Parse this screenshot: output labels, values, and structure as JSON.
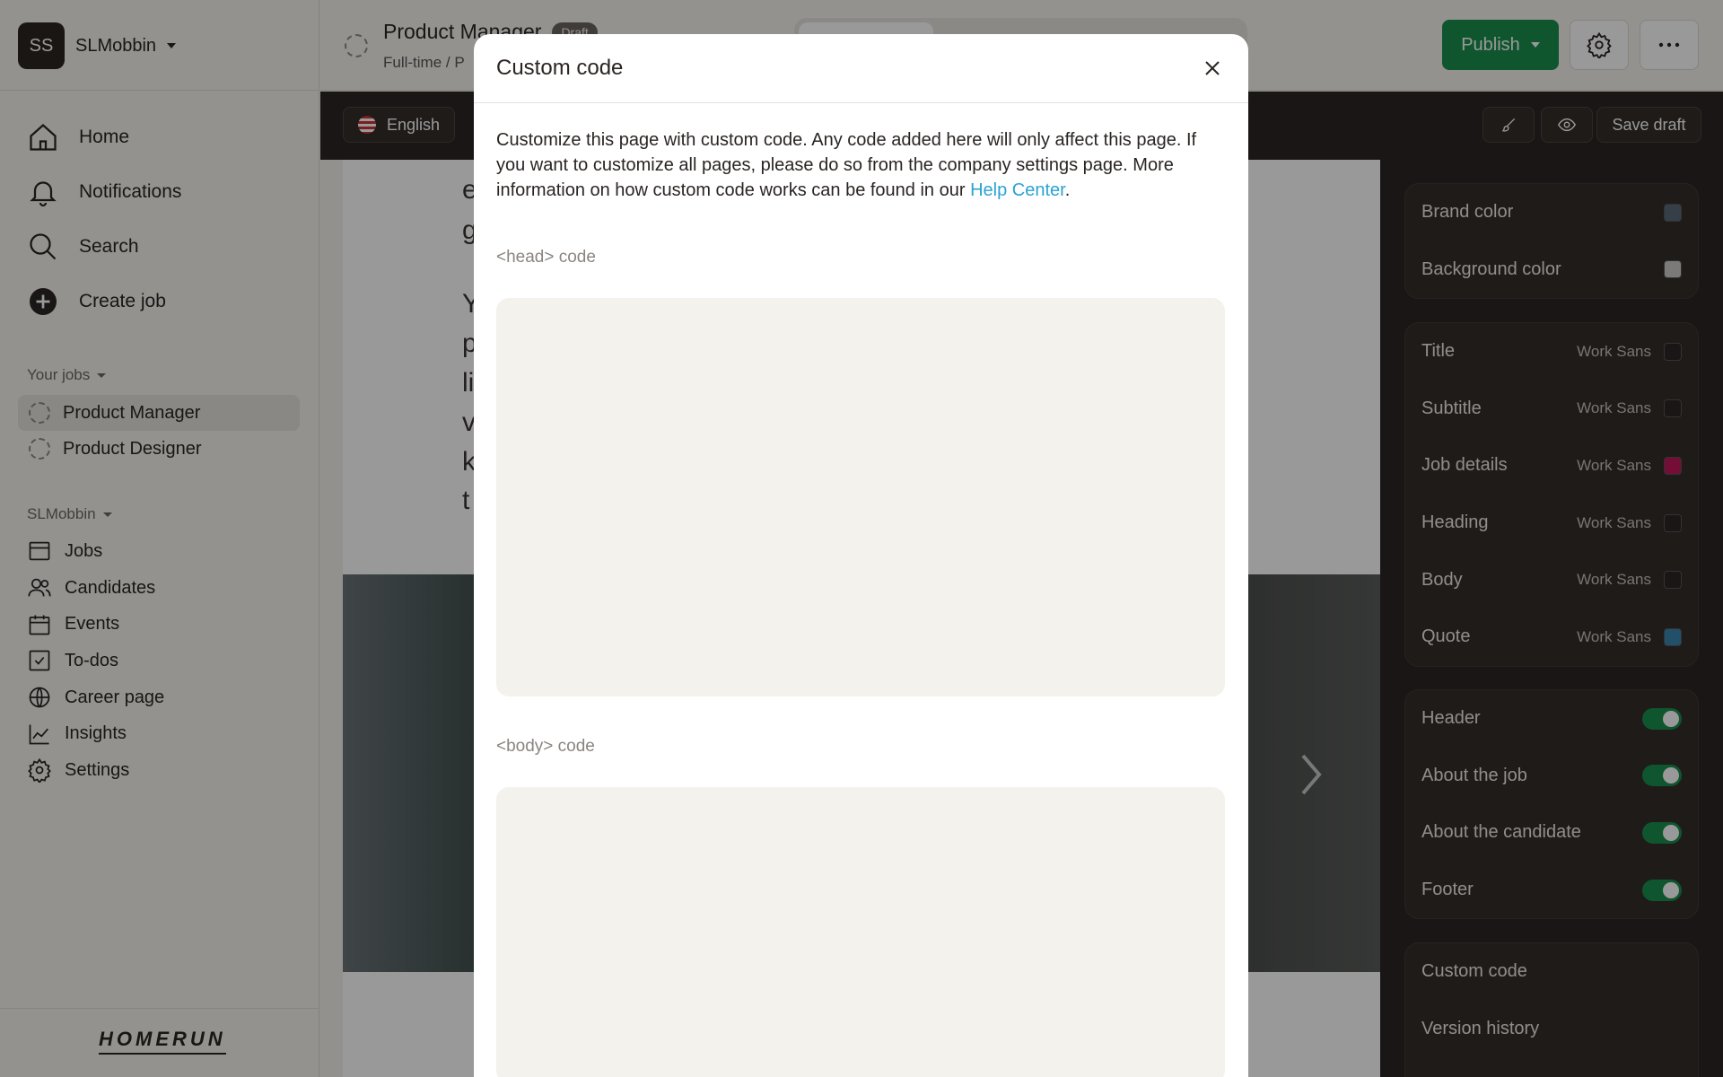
{
  "sidebar": {
    "avatar_initials": "SS",
    "workspace_name": "SLMobbin",
    "nav": [
      {
        "label": "Home",
        "icon": "home-icon"
      },
      {
        "label": "Notifications",
        "icon": "bell-icon"
      },
      {
        "label": "Search",
        "icon": "search-icon"
      },
      {
        "label": "Create job",
        "icon": "plus-circle-icon"
      }
    ],
    "your_jobs_label": "Your jobs",
    "jobs": [
      "Product Manager",
      "Product Designer"
    ],
    "org_label": "SLMobbin",
    "org_nav": [
      {
        "label": "Jobs",
        "icon": "window-icon"
      },
      {
        "label": "Candidates",
        "icon": "users-icon"
      },
      {
        "label": "Events",
        "icon": "calendar-icon"
      },
      {
        "label": "To-dos",
        "icon": "checkbox-icon"
      },
      {
        "label": "Career page",
        "icon": "globe-icon"
      },
      {
        "label": "Insights",
        "icon": "chart-icon"
      },
      {
        "label": "Settings",
        "icon": "gear-icon"
      }
    ],
    "logo_text": "HOMERUN"
  },
  "topbar": {
    "title": "Product Manager",
    "badge": "Draft",
    "subtitle": "Full-time / P",
    "publish_label": "Publish"
  },
  "subbar": {
    "language": "English",
    "save_draft": "Save draft"
  },
  "preview": {
    "text_lines": [
      "e",
      "g",
      "Y",
      "p",
      "li",
      "v",
      "k",
      "t"
    ]
  },
  "right_panel": {
    "colors": [
      {
        "label": "Brand color",
        "color": "#5a6a78"
      },
      {
        "label": "Background color",
        "color": "#cfccc8"
      }
    ],
    "fonts": [
      {
        "label": "Title",
        "font": "Work Sans",
        "color": "#2a2523"
      },
      {
        "label": "Subtitle",
        "font": "Work Sans",
        "color": "#2a2523"
      },
      {
        "label": "Job details",
        "font": "Work Sans",
        "color": "#c2185b"
      },
      {
        "label": "Heading",
        "font": "Work Sans",
        "color": "#2a2523"
      },
      {
        "label": "Body",
        "font": "Work Sans",
        "color": "#2a2523"
      },
      {
        "label": "Quote",
        "font": "Work Sans",
        "color": "#3a86b0"
      }
    ],
    "sections": [
      {
        "label": "Header",
        "on": true
      },
      {
        "label": "About the job",
        "on": true
      },
      {
        "label": "About the candidate",
        "on": true
      },
      {
        "label": "Footer",
        "on": true
      }
    ],
    "links": [
      "Custom code",
      "Version history"
    ]
  },
  "modal": {
    "title": "Custom code",
    "description": "Customize this page with custom code. Any code added here will only affect this page. If you want to customize all pages, please do so from the company settings page. More information on how custom code works can be found in our ",
    "link_text": "Help Center",
    "period": ".",
    "head_label": "<head> code",
    "body_label": "<body> code"
  }
}
